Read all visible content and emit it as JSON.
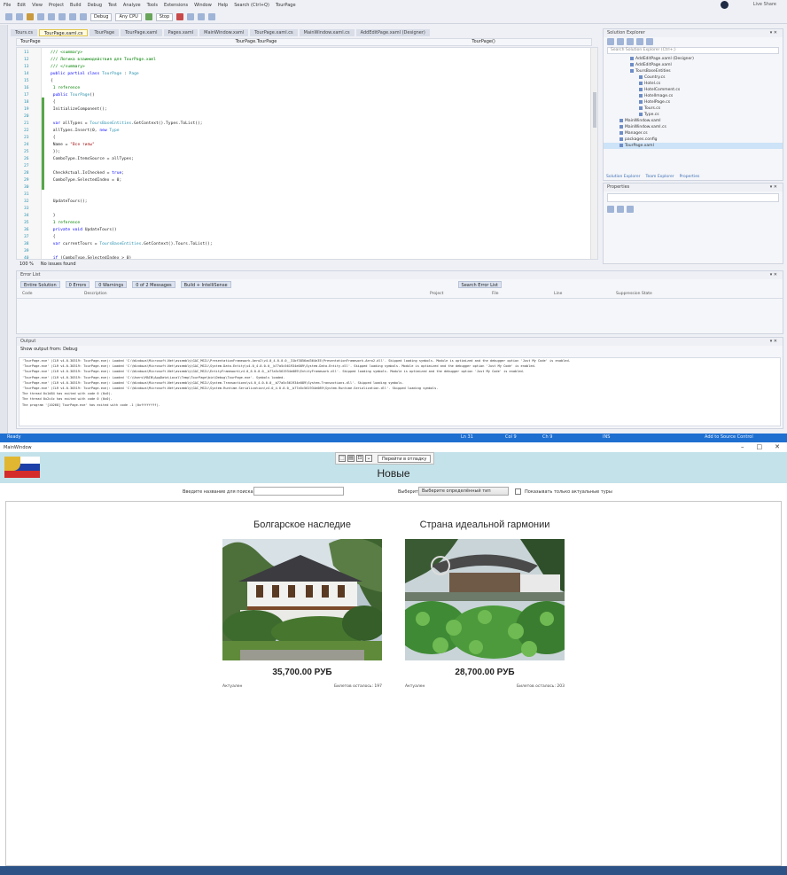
{
  "vs": {
    "menu": [
      "File",
      "Edit",
      "View",
      "Project",
      "Build",
      "Debug",
      "Test",
      "Analyze",
      "Tools",
      "Extensions",
      "Window",
      "Help",
      "Search (Ctrl+Q)",
      "TourPage"
    ],
    "account": "Live Share",
    "toolbar": {
      "config": "Debug",
      "platform": "Any CPU",
      "run": "Stop"
    },
    "doc_tabs": [
      "Tours.cs",
      "TourPage.xaml.cs",
      "TourPage",
      "TourPage.xaml",
      "Pages.xaml",
      "MainWindow.xaml",
      "TourPage.xaml.cs",
      "MainWindow.xaml.cs",
      "AddEditPage.xaml (Designer)"
    ],
    "nav": {
      "project": "TourPage",
      "class": "TourPage.TourPage",
      "member": "TourPage()"
    },
    "code_lines": [
      {
        "n": "11",
        "parts": [
          [
            "cm",
            "/// <summary>"
          ]
        ]
      },
      {
        "n": "12",
        "parts": [
          [
            "cm",
            "/// Логика взаимодействия для TourPage.xaml"
          ]
        ]
      },
      {
        "n": "13",
        "parts": [
          [
            "cm",
            "/// </summary>"
          ]
        ]
      },
      {
        "n": "14",
        "parts": [
          [
            "kw",
            "public partial class "
          ],
          [
            "ty",
            "TourPage"
          ],
          [
            "id",
            " : "
          ],
          [
            "ty",
            "Page"
          ]
        ]
      },
      {
        "n": "15",
        "parts": [
          [
            "id",
            "{"
          ]
        ]
      },
      {
        "n": "16",
        "parts": [
          [
            "cm",
            "    1 reference"
          ]
        ]
      },
      {
        "n": "17",
        "parts": [
          [
            "kw",
            "    public "
          ],
          [
            "ty",
            "TourPage"
          ],
          [
            "id",
            "()"
          ]
        ]
      },
      {
        "n": "18",
        "parts": [
          [
            "id",
            "    {"
          ]
        ]
      },
      {
        "n": "19",
        "parts": [
          [
            "id",
            "        InitializeComponent();"
          ]
        ]
      },
      {
        "n": "20",
        "parts": [
          [
            "id",
            ""
          ]
        ]
      },
      {
        "n": "21",
        "parts": [
          [
            "kw",
            "        var "
          ],
          [
            "id",
            "allTypes = "
          ],
          [
            "ty",
            "ToursBaseEntities"
          ],
          [
            "id",
            ".GetContext().Types.ToList();"
          ]
        ]
      },
      {
        "n": "22",
        "parts": [
          [
            "id",
            "        allTypes.Insert(0, "
          ],
          [
            "kw",
            "new "
          ],
          [
            "ty",
            "Type"
          ]
        ]
      },
      {
        "n": "23",
        "parts": [
          [
            "id",
            "        {"
          ]
        ]
      },
      {
        "n": "24",
        "parts": [
          [
            "id",
            "            Name = "
          ],
          [
            "st",
            "\"Все типы\""
          ]
        ]
      },
      {
        "n": "25",
        "parts": [
          [
            "id",
            "        });"
          ]
        ]
      },
      {
        "n": "26",
        "parts": [
          [
            "id",
            "        ComboType.ItemsSource = allTypes;"
          ]
        ]
      },
      {
        "n": "27",
        "parts": [
          [
            "id",
            ""
          ]
        ]
      },
      {
        "n": "28",
        "parts": [
          [
            "id",
            "        CheckActual.IsChecked = "
          ],
          [
            "kw",
            "true"
          ],
          [
            "id",
            ";"
          ]
        ]
      },
      {
        "n": "29",
        "parts": [
          [
            "id",
            "        ComboType.SelectedIndex = 0;"
          ]
        ]
      },
      {
        "n": "30",
        "parts": [
          [
            "id",
            ""
          ]
        ]
      },
      {
        "n": "31",
        "parts": [
          [
            "id",
            ""
          ]
        ]
      },
      {
        "n": "32",
        "parts": [
          [
            "id",
            "        UpdateTours();"
          ]
        ]
      },
      {
        "n": "33",
        "parts": [
          [
            "id",
            ""
          ]
        ]
      },
      {
        "n": "34",
        "parts": [
          [
            "id",
            "    }"
          ]
        ]
      },
      {
        "n": "35",
        "parts": [
          [
            "cm",
            "    1 reference"
          ]
        ]
      },
      {
        "n": "36",
        "parts": [
          [
            "kw",
            "    private void "
          ],
          [
            "id",
            "UpdateTours()"
          ]
        ]
      },
      {
        "n": "37",
        "parts": [
          [
            "id",
            "    {"
          ]
        ]
      },
      {
        "n": "38",
        "parts": [
          [
            "kw",
            "        var "
          ],
          [
            "id",
            "currentTours = "
          ],
          [
            "ty",
            "ToursBaseEntities"
          ],
          [
            "id",
            ".GetContext().Tours.ToList();"
          ]
        ]
      },
      {
        "n": "39",
        "parts": [
          [
            "id",
            ""
          ]
        ]
      },
      {
        "n": "40",
        "parts": [
          [
            "kw",
            "        if "
          ],
          [
            "id",
            "(ComboType.SelectedIndex > 0)"
          ]
        ]
      }
    ],
    "zoom": "100 %",
    "no_issues": "No issues found",
    "solution": {
      "title": "Solution Explorer",
      "search": "Search Solution Explorer (Ctrl+;)",
      "items": [
        "AddEditPage.xaml (Designer)",
        "AddEditPage.xaml",
        "ToursBaseEntities",
        "Country.cs",
        "Hotel.cs",
        "HotelComment.cs",
        "HotelImage.cs",
        "HotelPage.cs",
        "Tours.cs",
        "Type.cs",
        "MainWindow.xaml",
        "MainWindow.xaml.cs",
        "Manager.cs",
        "packages.config",
        "TourPage.xaml"
      ],
      "tabs": [
        "Solution Explorer",
        "Team Explorer",
        "Properties"
      ]
    },
    "properties": {
      "title": "Properties"
    },
    "error_list": {
      "title": "Error List",
      "scope": "Entire Solution",
      "errors": "0 Errors",
      "warnings": "0 Warnings",
      "messages": "0 of 2 Messages",
      "build": "Build + IntelliSense",
      "search": "Search Error List",
      "cols": [
        "Code",
        "Description",
        "Project",
        "File",
        "Line",
        "Suppression State"
      ]
    },
    "output": {
      "title": "Output",
      "source": "Show output from:  Debug",
      "lines": [
        "'TourPage.exe' (CLR v4.0.30319: TourPage.exe): Loaded 'C:\\Windows\\Microsoft.Net\\assembly\\GAC_MSIL\\PresentationFramework.Aero2\\v4.0_4.0.0.0__31bf3856ad364e35\\PresentationFramework.Aero2.dll'. Skipped loading symbols. Module is optimized and the debugger option 'Just My Code' is enabled.",
        "'TourPage.exe' (CLR v4.0.30319: TourPage.exe): Loaded 'C:\\Windows\\Microsoft.Net\\assembly\\GAC_MSIL\\System.Data.Entity\\v4.0_4.0.0.0__b77a5c561934e089\\System.Data.Entity.dll'. Skipped loading symbols. Module is optimized and the debugger option 'Just My Code' is enabled.",
        "'TourPage.exe' (CLR v4.0.30319: TourPage.exe): Loaded 'C:\\Windows\\Microsoft.Net\\assembly\\GAC_MSIL\\EntityFramework\\v4.0_6.0.0.0__b77a5c561934e089\\EntityFramework.dll'. Skipped loading symbols. Module is optimized and the debugger option 'Just My Code' is enabled.",
        "'TourPage.exe' (CLR v4.0.30319: TourPage.exe): Loaded 'C:\\Users\\MAIN\\AppData\\Local\\Temp\\TourPage\\bin\\Debug\\TourPage.exe'. Symbols loaded.",
        "'TourPage.exe' (CLR v4.0.30319: TourPage.exe): Loaded 'C:\\Windows\\Microsoft.Net\\assembly\\GAC_MSIL\\System.Transactions\\v4.0_4.0.0.0__b77a5c561934e089\\System.Transactions.dll'. Skipped loading symbols.",
        "'TourPage.exe' (CLR v4.0.30319: TourPage.exe): Loaded 'C:\\Windows\\Microsoft.Net\\assembly\\GAC_MSIL\\System.Runtime.Serialization\\v4.0_4.0.0.0__b77a5c561934e089\\System.Runtime.Serialization.dll'. Skipped loading symbols.",
        "The thread 0x1d84 has exited with code 0 (0x0).",
        "The thread 0x2c4c has exited with code 0 (0x0).",
        "The program '[10268] TourPage.exe' has exited with code -1 (0xffffffff)."
      ]
    },
    "status": {
      "left": "Ready",
      "ln": "Ln 31",
      "col": "Col 9",
      "ch": "Ch 9",
      "ins": "INS",
      "right": "Add to Source Control"
    }
  },
  "app": {
    "window_title": "MainWindow",
    "header_title": "Новые",
    "debug_button": "Перейти в отладку",
    "search_label": "Введите название для поиска",
    "type_label": "Выберите тип",
    "type_value": "Выберите определённый тип",
    "actual_label": "Показывать только актуальные туры",
    "tours": [
      {
        "title": "Болгарское наследие",
        "price": "35,700.00 РУБ",
        "status": "Актуален",
        "tickets": "Билетов осталось: 197"
      },
      {
        "title": "Страна идеальной гармонии",
        "price": "28,700.00 РУБ",
        "status": "Актуален",
        "tickets": "Билетов осталось: 203"
      }
    ]
  }
}
